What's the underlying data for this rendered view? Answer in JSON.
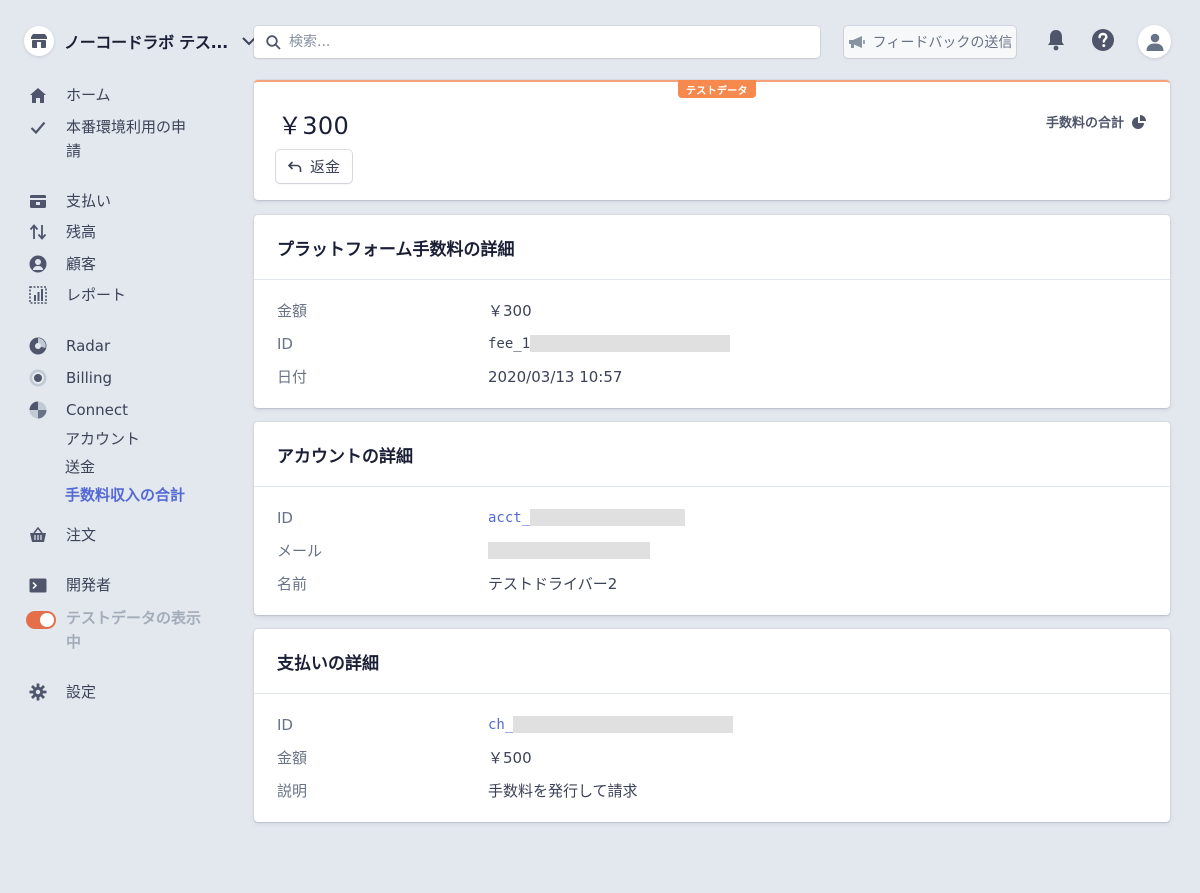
{
  "account": {
    "name": "ノーコードラボ テス..."
  },
  "search": {
    "placeholder": "検索..."
  },
  "header": {
    "feedback_label": "フィードバックの送信"
  },
  "sidebar": {
    "items": [
      {
        "label": "ホーム",
        "icon": "home-icon"
      },
      {
        "label": "本番環境利用の申",
        "label2": "請",
        "icon": "check-icon"
      },
      {
        "label": "支払い",
        "icon": "payments-icon"
      },
      {
        "label": "残高",
        "icon": "balance-arrows-icon"
      },
      {
        "label": "顧客",
        "icon": "customer-icon"
      },
      {
        "label": "レポート",
        "icon": "report-icon"
      },
      {
        "label": "Radar",
        "icon": "radar-icon"
      },
      {
        "label": "Billing",
        "icon": "billing-icon"
      },
      {
        "label": "Connect",
        "icon": "connect-icon"
      },
      {
        "label": "注文",
        "icon": "basket-icon"
      },
      {
        "label": "開発者",
        "icon": "terminal-icon"
      },
      {
        "label": "設定",
        "icon": "gear-icon"
      }
    ],
    "connect_sub": [
      "アカウント",
      "送金",
      "手数料収入の合計"
    ],
    "active_sub": "手数料収入の合計",
    "test_toggle": {
      "label": "テストデータの表示",
      "label2": "中",
      "on": true
    }
  },
  "summary": {
    "badge": "テストデータ",
    "amount": "￥300",
    "refund_label": "返金",
    "fee_total_label": "手数料の合計"
  },
  "fee_details": {
    "title": "プラットフォーム手数料の詳細",
    "rows": [
      {
        "key": "金額",
        "value": "￥300"
      },
      {
        "key": "ID",
        "value": "fee_1"
      },
      {
        "key": "日付",
        "value": "2020/03/13 10:57"
      }
    ]
  },
  "account_details": {
    "title": "アカウントの詳細",
    "rows": [
      {
        "key": "ID",
        "value": "acct_"
      },
      {
        "key": "メール",
        "value": ""
      },
      {
        "key": "名前",
        "value": "テストドライバー2"
      }
    ]
  },
  "payment_details": {
    "title": "支払いの詳細",
    "rows": [
      {
        "key": "ID",
        "value": "ch_"
      },
      {
        "key": "金額",
        "value": "￥500"
      },
      {
        "key": "説明",
        "value": "手数料を発行して請求"
      }
    ]
  },
  "colors": {
    "accent": "#5469d4",
    "test_orange": "#f6894e",
    "background": "#e3e8ee"
  }
}
